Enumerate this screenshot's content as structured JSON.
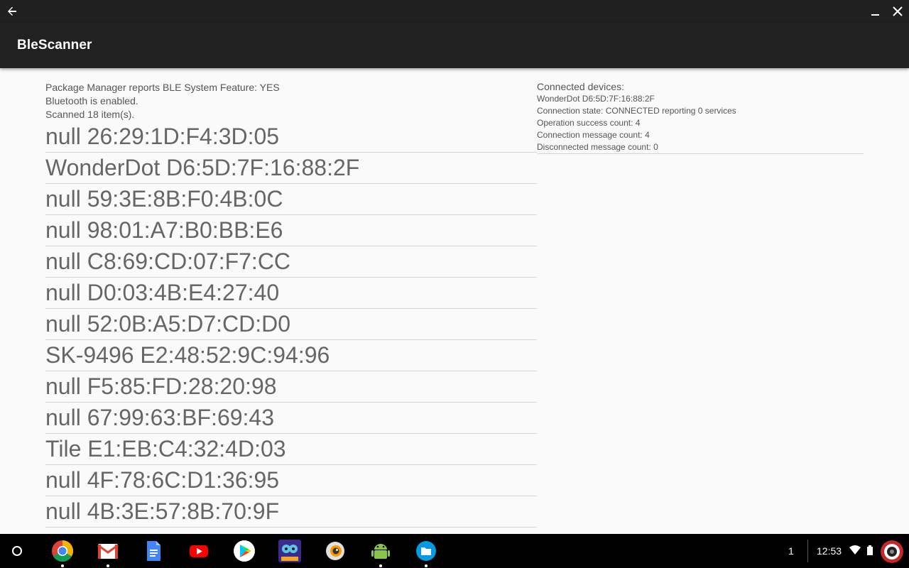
{
  "app": {
    "title": "BleScanner"
  },
  "status": {
    "lines": [
      "Package Manager reports BLE System Feature: YES",
      "Bluetooth is enabled.",
      "Scanned 18 item(s)."
    ]
  },
  "devices": [
    "null 26:29:1D:F4:3D:05",
    "WonderDot D6:5D:7F:16:88:2F",
    "null 59:3E:8B:F0:4B:0C",
    "null 98:01:A7:B0:BB:E6",
    "null C8:69:CD:07:F7:CC",
    "null D0:03:4B:E4:27:40",
    "null 52:0B:A5:D7:CD:D0",
    "SK-9496 E2:48:52:9C:94:96",
    "null F5:85:FD:28:20:98",
    "null 67:99:63:BF:69:43",
    "Tile E1:EB:C4:32:4D:03",
    "null 4F:78:6C:D1:36:95",
    "null 4B:3E:57:8B:70:9F"
  ],
  "connected": {
    "title": "Connected devices:",
    "device": "WonderDot D6:5D:7F:16:88:2F",
    "state": "Connection state: CONNECTED reporting 0 services",
    "success": "Operation success count: 4",
    "messages": "Connection message count: 4",
    "disconnected": "Disconnected message count: 0"
  },
  "shelf": {
    "apps": [
      "chrome-icon",
      "gmail-icon",
      "docs-icon",
      "youtube-icon",
      "play-store-icon",
      "game-icon",
      "camera-icon",
      "android-icon",
      "files-icon"
    ],
    "notification_count": "1",
    "time": "12:53"
  },
  "colors": {
    "app_bar": "#212121",
    "window_bar": "#202020",
    "background": "#fafafa",
    "text": "#555555"
  }
}
